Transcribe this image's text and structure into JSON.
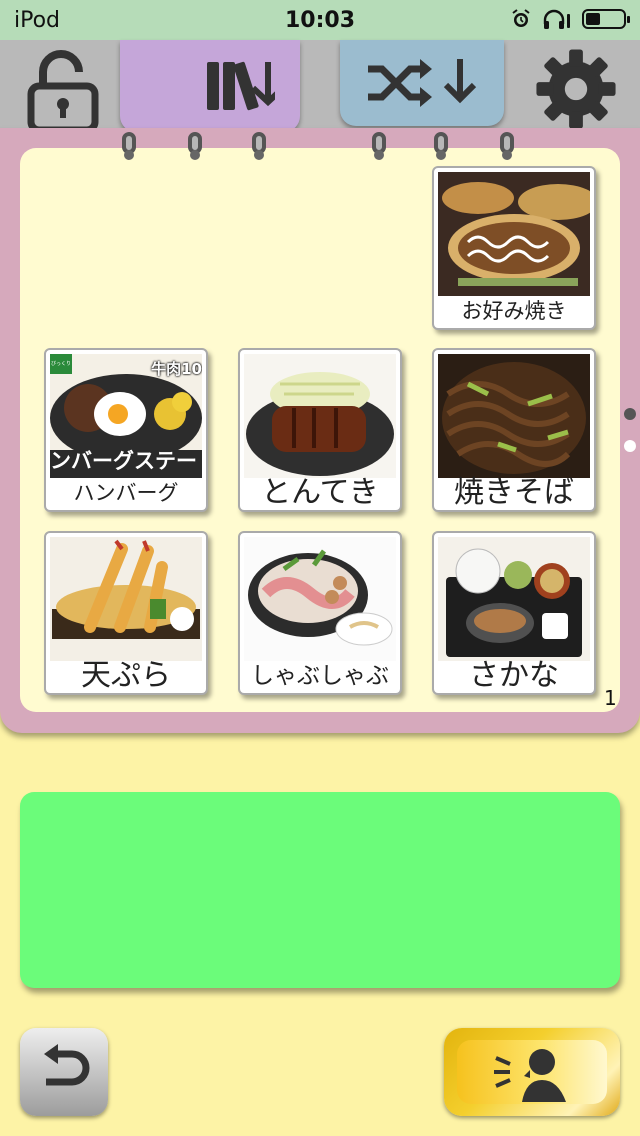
{
  "status_bar": {
    "carrier": "iPod",
    "time": "10:03"
  },
  "toolbar": {
    "lock_icon": "unlock-icon",
    "books_tab_icon": "books-icon",
    "shuffle_tab_icon": "shuffle-icon",
    "settings_icon": "gear-icon"
  },
  "cards": [
    {
      "label": "お好み焼き",
      "image": "okonomiyaki"
    },
    {
      "label": "ハンバーグ",
      "image": "hamburg-steak",
      "image_text": {
        "brand": "びっくりドンキー",
        "badge": "牛肉10",
        "banner": "ンバーグステー"
      }
    },
    {
      "label": "とんてき",
      "image": "tonteki"
    },
    {
      "label": "焼きそば",
      "image": "yakisoba"
    },
    {
      "label": "天ぷら",
      "image": "tempura"
    },
    {
      "label": "しゃぶしゃぶ",
      "image": "shabu-shabu"
    },
    {
      "label": "さかな",
      "image": "grilled-fish-set"
    }
  ],
  "page_number": "1",
  "message_bar": {
    "text": ""
  },
  "colors": {
    "status_bar": "#b6dcb8",
    "books_tab": "#c5a6d9",
    "shuffle_tab": "#9bbccf",
    "binder": "#d6a9bc",
    "page": "#fffbd0",
    "message_bar": "#6bfc7a",
    "background": "#fdf3a6"
  }
}
